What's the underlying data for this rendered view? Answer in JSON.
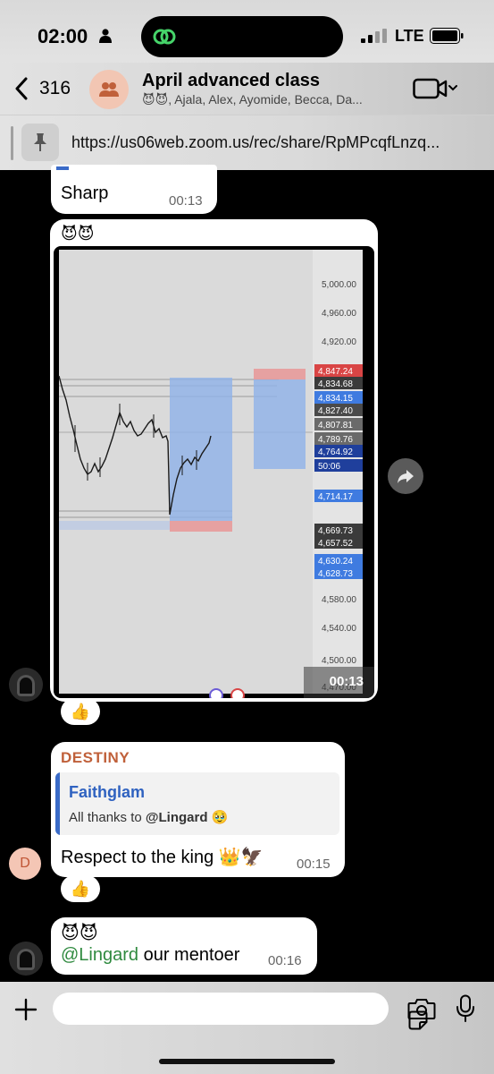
{
  "status_bar": {
    "time": "02:00",
    "network": "LTE"
  },
  "header": {
    "back_count": "316",
    "title": "April advanced class",
    "subtitle": "😈😈, Ajala, Alex, Ayomide, Becca, Da..."
  },
  "pinned": {
    "url": "https://us06web.zoom.us/rec/share/RpMPcqfLnzq..."
  },
  "messages": {
    "sharp": {
      "text": "Sharp",
      "time": "00:13"
    },
    "chart": {
      "emojis": "😈😈",
      "time": "00:13",
      "reaction": "👍"
    },
    "destiny": {
      "sender": "DESTINY",
      "reply_name": "Faithglam",
      "reply_prefix": "All thanks to ",
      "reply_mention": "@Lingard",
      "reply_emoji": " 🥹",
      "text": "Respect to the king 👑🦅",
      "time": "00:15",
      "avatar_initial": "D",
      "reaction": "👍"
    },
    "mentor": {
      "emojis": "😈😈",
      "mention": "@Lingard",
      "text": " our mentoer",
      "time": "00:16"
    }
  },
  "price_chart": {
    "price_scale": [
      "5,000.00",
      "4,960.00",
      "4,920.00",
      "4,580.00",
      "4,540.00",
      "4,500.00",
      "4,470.00",
      "4,4"
    ],
    "price_tags": [
      {
        "label": "4,847.24",
        "color": "#d94545"
      },
      {
        "label": "4,834.68",
        "color": "#3b3b3b"
      },
      {
        "label": "4,834.15",
        "color": "#3f7be0"
      },
      {
        "label": "4,827.40",
        "color": "#4a4a4a"
      },
      {
        "label": "4,807.81",
        "color": "#6a6a6a"
      },
      {
        "label": "4,789.76",
        "color": "#6a6a6a"
      },
      {
        "label": "4,764.92",
        "color": "#1f3f9c"
      },
      {
        "label": "50:06",
        "color": "#1f3f9c"
      },
      {
        "label": "4,714.17",
        "color": "#3f7be0"
      },
      {
        "label": "4,669.73",
        "color": "#3b3b3b"
      },
      {
        "label": "4,657.52",
        "color": "#3b3b3b"
      },
      {
        "label": "4,630.24",
        "color": "#3f7be0"
      },
      {
        "label": "4,628.73",
        "color": "#3f7be0"
      }
    ]
  },
  "colors": {
    "accent_blue": "#3a6bc8",
    "sender_orange": "#c0603a",
    "mention_green": "#2f8a3f",
    "chart_zone_blue": "#8fb1e8",
    "chart_zone_red": "#e79a9a"
  }
}
